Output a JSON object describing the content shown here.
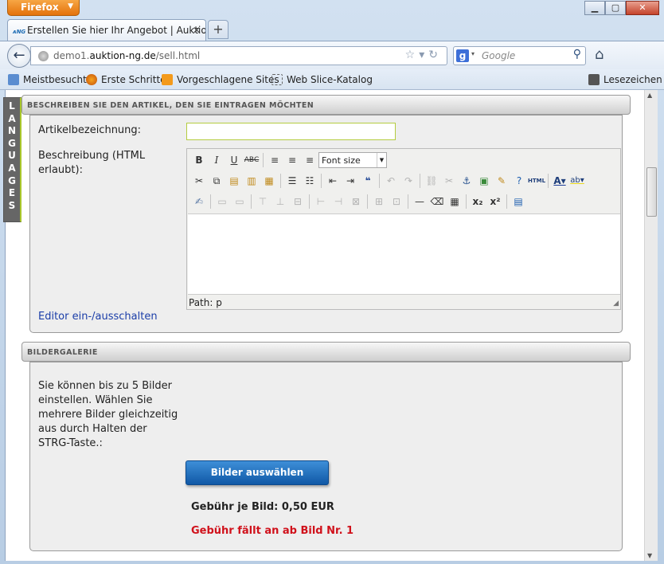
{
  "browser": {
    "app_button": "Firefox",
    "tab_title": "Erstellen Sie hier Ihr Angebot | Auktion:N...",
    "tab_favicon_text": "ᴀNG",
    "url_prefix": "demo1.",
    "url_domain": "auktion-ng.de",
    "url_path": "/sell.html",
    "search_engine_letter": "g",
    "search_placeholder": "Google",
    "bookmarks": [
      "Meistbesucht",
      "Erste Schritte",
      "Vorgeschlagene Sites",
      "Web Slice-Katalog"
    ],
    "bookmarks_menu": "Lesezeichen"
  },
  "sidebar": {
    "languages_letters": [
      "L",
      "A",
      "N",
      "G",
      "U",
      "A",
      "G",
      "E",
      "S"
    ]
  },
  "article_section": {
    "title": "BESCHREIBEN SIE DEN ARTIKEL, DEN SIE EINTRAGEN MÖCHTEN",
    "name_label": "Artikelbezeichnung:",
    "name_value": "",
    "description_label_line1": "Beschreibung (HTML",
    "description_label_line2": "erlaubt):",
    "font_size_select": "Font size",
    "html_button": "HTML",
    "path_label": "Path: p",
    "toggle_editor_link": "Editor ein-/ausschalten"
  },
  "gallery_section": {
    "title": "BILDERGALERIE",
    "intro_lines": [
      "Sie können bis zu 5 Bilder",
      "einstellen. Wählen Sie",
      "mehrere Bilder gleichzeitig",
      "aus durch Halten der",
      "STRG-Taste.:"
    ],
    "select_button": "Bilder auswählen",
    "fee_per_image": "Gebühr je Bild: 0,50 EUR",
    "fee_notice": "Gebühr fällt an ab Bild Nr. 1"
  },
  "colors": {
    "firefox_button": "#e4720b",
    "gallery_button": "#1058a6",
    "fee_notice": "#d0111b",
    "link": "#1a3da8",
    "input_border": "#b4cc40"
  }
}
